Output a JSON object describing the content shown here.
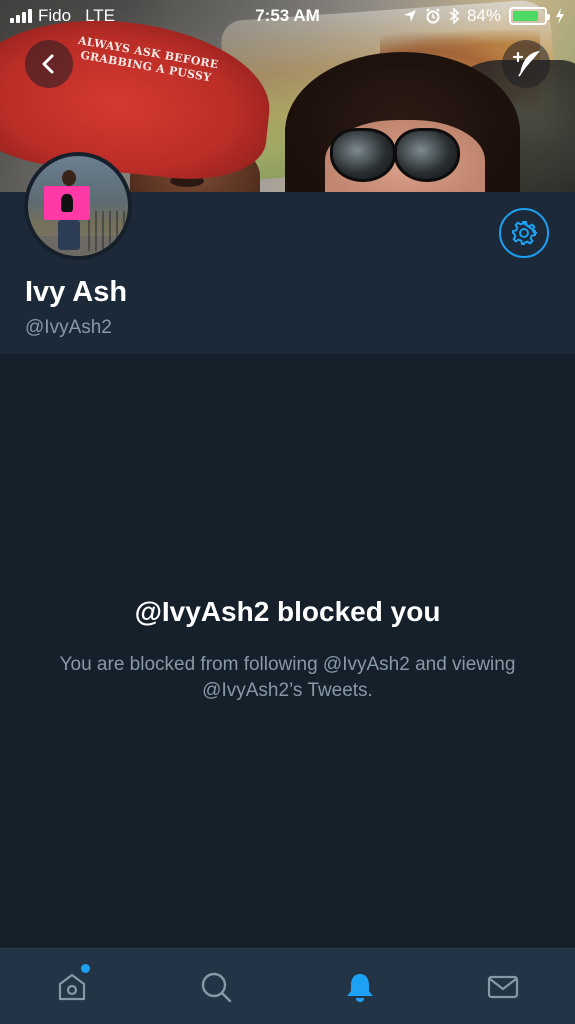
{
  "status_bar": {
    "carrier": "Fido",
    "network": "LTE",
    "time": "7:53 AM",
    "battery_percent": "84%",
    "battery_level": 0.84,
    "icons": [
      "signal-icon",
      "location-icon",
      "alarm-icon",
      "bluetooth-icon",
      "battery-icon",
      "charging-icon"
    ]
  },
  "header": {
    "cap_text_line1": "ALWAYS ASK BEFORE",
    "cap_text_line2": "GRABBING A PUSSY",
    "back_button_icon": "chevron-left-icon",
    "compose_button_icon": "compose-tweet-icon"
  },
  "profile": {
    "name": "Ivy Ash",
    "handle": "@IvyAsh2",
    "settings_icon": "gear-icon"
  },
  "blocked": {
    "title": "@IvyAsh2 blocked you",
    "description": "You are blocked from following @IvyAsh2 and viewing @IvyAsh2’s Tweets."
  },
  "tab_bar": {
    "tabs": [
      {
        "name": "home",
        "icon": "home-icon",
        "active": false,
        "has_notification_dot": true
      },
      {
        "name": "search",
        "icon": "search-icon",
        "active": false
      },
      {
        "name": "notifications",
        "icon": "bell-icon",
        "active": true
      },
      {
        "name": "messages",
        "icon": "mail-icon",
        "active": false
      }
    ]
  },
  "colors": {
    "background": "#15202b",
    "profile_background": "#1c2938",
    "tab_bar_background": "#243447",
    "accent": "#1da1f2",
    "secondary_text": "#8899a6",
    "battery_green": "#4cd964"
  }
}
